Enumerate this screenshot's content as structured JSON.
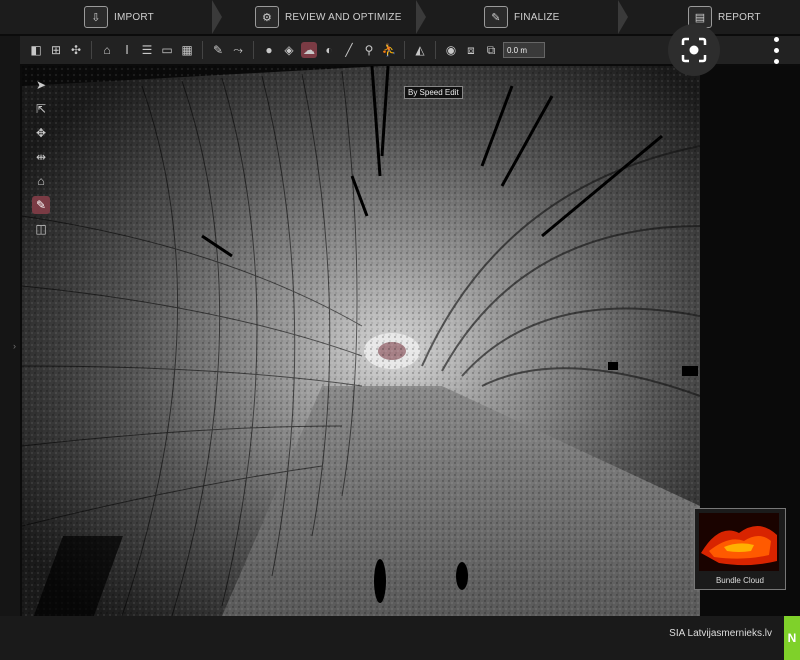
{
  "workflow": {
    "steps": [
      {
        "label": "IMPORT",
        "icon": "import-icon"
      },
      {
        "label": "REVIEW AND OPTIMIZE",
        "icon": "gear-icon"
      },
      {
        "label": "FINALIZE",
        "icon": "finalize-icon"
      },
      {
        "label": "REPORT",
        "icon": "report-icon"
      }
    ]
  },
  "toolbar": {
    "scale_value": "0.0 m",
    "icons": [
      "cube-icon",
      "snap-icon",
      "target-icon",
      "home-icon",
      "grid-icon",
      "list-icon",
      "layers-icon",
      "table-icon",
      "pencil-icon",
      "link-icon",
      "globe-icon",
      "tag-icon",
      "cloud-icon",
      "sphere-icon",
      "ruler-icon",
      "pin-icon",
      "walk-icon",
      "view-icon",
      "eye-icon",
      "cube-outline-icon",
      "box-icon"
    ]
  },
  "tools": {
    "items": [
      "select-arrow-icon",
      "select-add-icon",
      "move-icon",
      "fit-icon",
      "home-view-icon",
      "edit-pencil-icon",
      "cube-icon"
    ],
    "active_index": 5
  },
  "viewport": {
    "tooltip": "By Speed Edit"
  },
  "thumbnail": {
    "caption": "Bundle Cloud"
  },
  "status": {
    "credit": "SIA Latvijasmernieks.lv"
  },
  "colors": {
    "active": "#7a3b44",
    "brand": "#7fd12a"
  }
}
